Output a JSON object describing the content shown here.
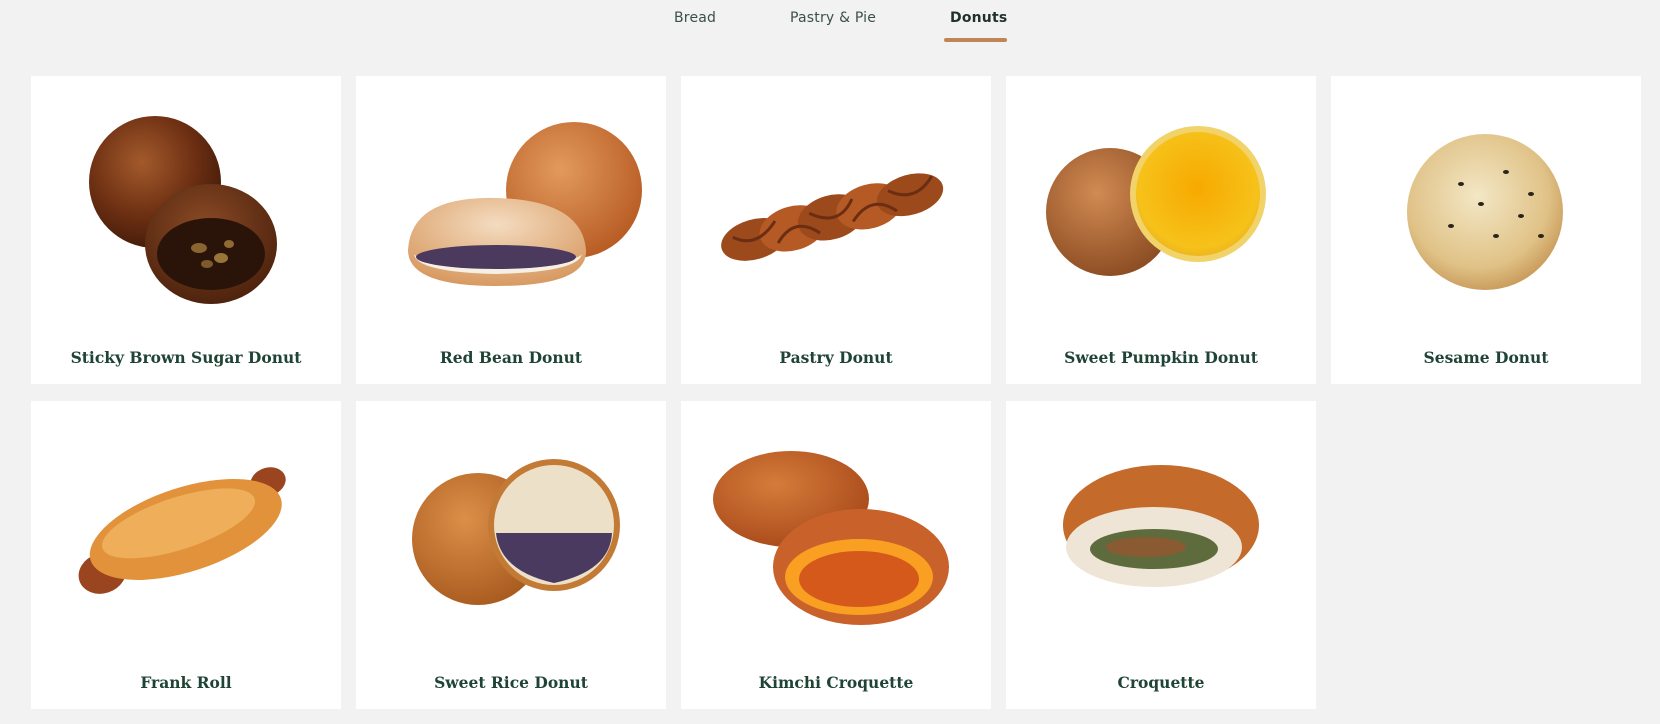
{
  "tabs": [
    {
      "label": "Bread",
      "active": false
    },
    {
      "label": "Pastry & Pie",
      "active": false
    },
    {
      "label": "Donuts",
      "active": true
    }
  ],
  "accent_color": "#c08455",
  "products": [
    {
      "name": "Sticky Brown Sugar Donut",
      "image": "sticky-brown-sugar-donut-image"
    },
    {
      "name": "Red Bean Donut",
      "image": "red-bean-donut-image"
    },
    {
      "name": "Pastry Donut",
      "image": "pastry-donut-image"
    },
    {
      "name": "Sweet Pumpkin Donut",
      "image": "sweet-pumpkin-donut-image"
    },
    {
      "name": "Sesame Donut",
      "image": "sesame-donut-image"
    },
    {
      "name": "Frank Roll",
      "image": "frank-roll-image"
    },
    {
      "name": "Sweet Rice Donut",
      "image": "sweet-rice-donut-image"
    },
    {
      "name": "Kimchi Croquette",
      "image": "kimchi-croquette-image"
    },
    {
      "name": "Croquette",
      "image": "croquette-image"
    }
  ]
}
